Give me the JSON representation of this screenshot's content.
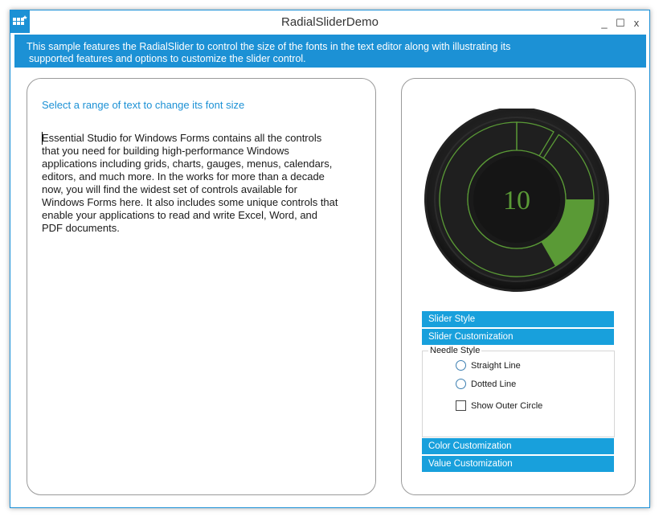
{
  "window": {
    "title": "RadialSliderDemo",
    "minimize": "_",
    "maximize": "☐",
    "close": "x"
  },
  "banner": {
    "line1": "This sample features the RadialSlider to control the size of the fonts in the text editor along with illustrating its",
    "line2": "supported features and options to customize the slider control."
  },
  "editor": {
    "hint": "Select a range of text to change its font size",
    "text": "Essential Studio for Windows Forms contains all the controls that you need for building high-performance Windows applications including grids, charts, gauges, menus, calendars, editors, and much more. In the works for more than a decade now, you will find the widest set of controls available for Windows Forms here. It also includes some unique controls that enable your applications to read and write Excel, Word, and PDF documents."
  },
  "slider": {
    "value": "10",
    "accent_color": "#5a9a36"
  },
  "accordion": {
    "slider_style": "Slider Style",
    "slider_customization": "Slider Customization",
    "color_customization": "Color Customization",
    "value_customization": "Value Customization"
  },
  "needle": {
    "title": "Needle Style",
    "straight": "Straight Line",
    "dotted": "Dotted Line",
    "outer_circle": "Show Outer Circle"
  }
}
